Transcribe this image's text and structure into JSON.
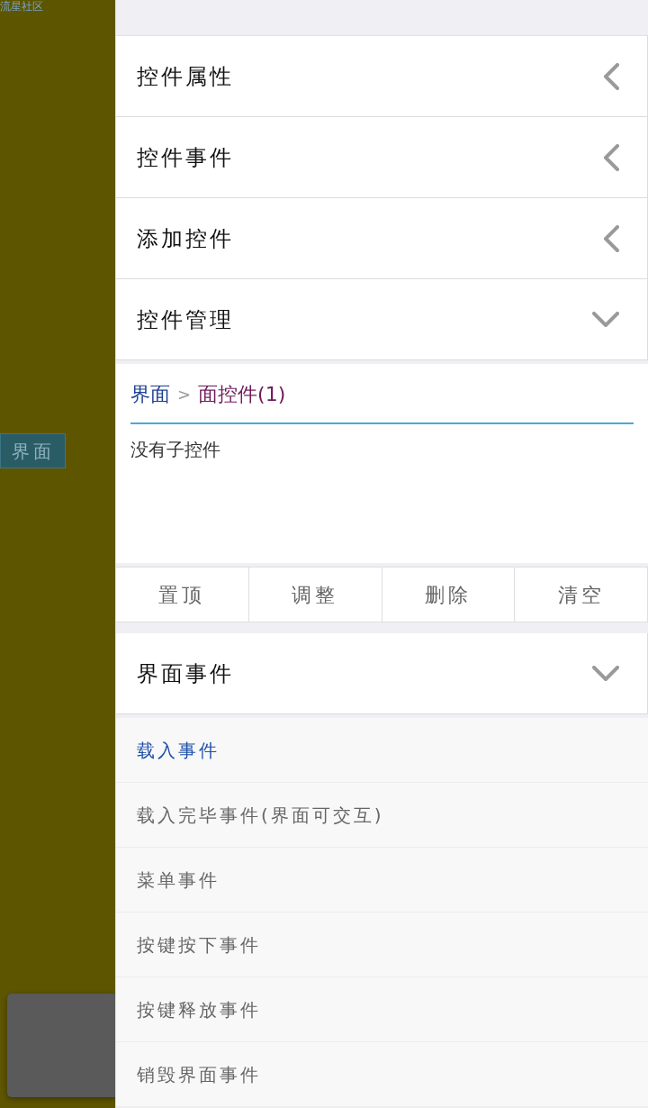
{
  "background": {
    "site_label": "流星社区",
    "floating_button": "界面"
  },
  "panel": {
    "sections": [
      {
        "title": "控件属性",
        "expanded": false
      },
      {
        "title": "控件事件",
        "expanded": false
      },
      {
        "title": "添加控件",
        "expanded": false
      },
      {
        "title": "控件管理",
        "expanded": true,
        "kind": "manager",
        "breadcrumb": {
          "separator": ">",
          "items": [
            {
              "label": "界面",
              "current": false
            },
            {
              "label": "面控件(1)",
              "current": true
            }
          ]
        },
        "message": "没有子控件",
        "actions": [
          "置顶",
          "调整",
          "删除",
          "清空"
        ]
      },
      {
        "title": "界面事件",
        "expanded": true,
        "kind": "events",
        "events": [
          {
            "label": "载入事件",
            "selected": true
          },
          {
            "label": "载入完毕事件(界面可交互)",
            "selected": false
          },
          {
            "label": "菜单事件",
            "selected": false
          },
          {
            "label": "按键按下事件",
            "selected": false
          },
          {
            "label": "按键释放事件",
            "selected": false
          },
          {
            "label": "销毁界面事件",
            "selected": false
          }
        ]
      }
    ]
  }
}
